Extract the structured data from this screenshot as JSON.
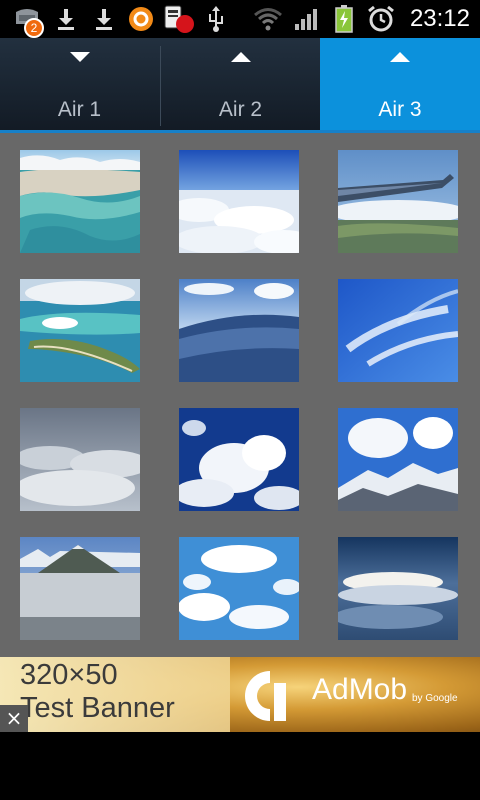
{
  "status_bar": {
    "notification_count": "2",
    "time": "23:12",
    "icons": [
      "notification-icon",
      "download-icon",
      "download-icon",
      "avast-icon",
      "card-app-icon",
      "usb-icon",
      "wifi-icon",
      "signal-icon",
      "battery-charging-icon",
      "alarm-icon"
    ]
  },
  "tabs": [
    {
      "label": "Air 1",
      "arrow": "down",
      "active": false
    },
    {
      "label": "Air 2",
      "arrow": "up",
      "active": false
    },
    {
      "label": "Air 3",
      "arrow": "up",
      "active": true
    }
  ],
  "gallery": {
    "thumbnails": [
      "coastal-lagoon-aerial",
      "sea-of-clouds",
      "airplane-wing-over-land",
      "island-aerial",
      "horizon-above-clouds",
      "wispy-cirrus-sky",
      "grey-cloud-layer",
      "cumulus-deep-blue-sky",
      "snowy-mountains-and-clouds",
      "volcano-above-fog",
      "scattered-cumulus-sky",
      "sunlit-cloudscape"
    ]
  },
  "ad": {
    "size_text": "320×50",
    "test_text": "Test Banner",
    "brand": "AdMob",
    "by": "by Google",
    "close": "×"
  },
  "colors": {
    "accent_tab": "#0c91dc",
    "grid_background": "#686868",
    "tabbar_dark": "#1a2430"
  }
}
